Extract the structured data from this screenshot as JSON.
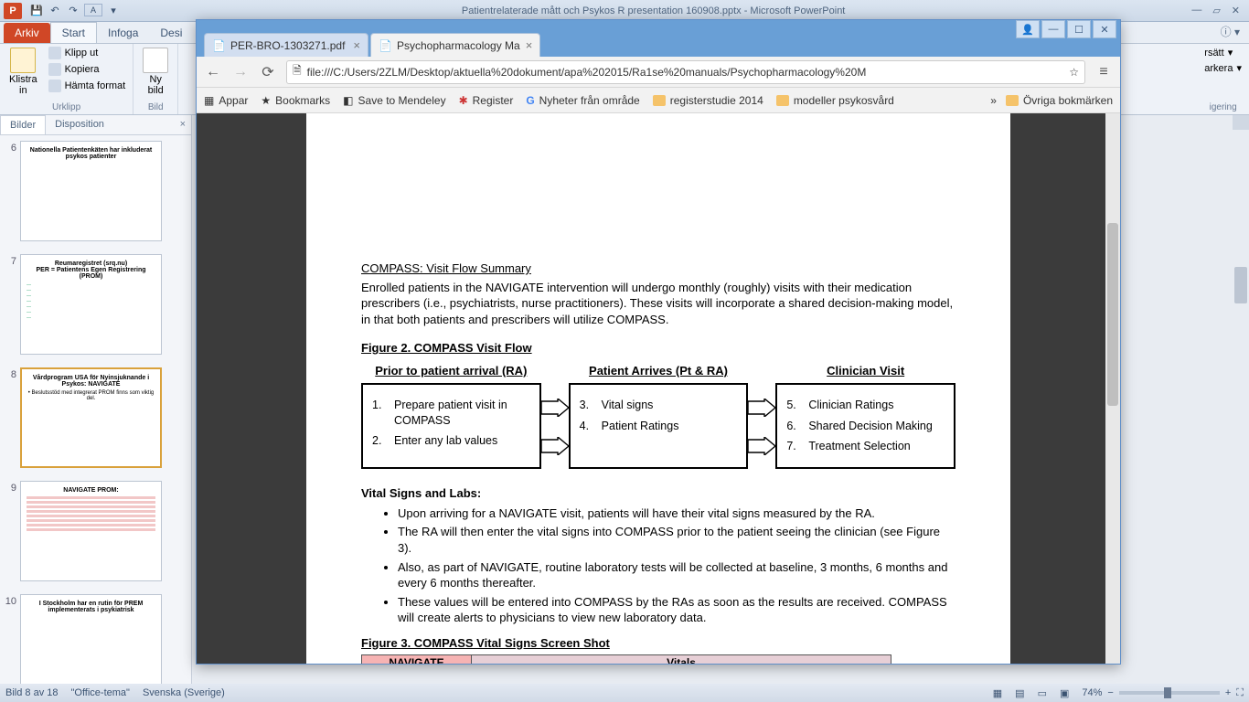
{
  "powerpoint": {
    "title": "Patientrelaterade mått och Psykos R presentation 160908.pptx  -  Microsoft PowerPoint",
    "logo": "P",
    "tabs": {
      "file": "Arkiv",
      "home": "Start",
      "insert": "Infoga",
      "design": "Desi"
    },
    "ribbon": {
      "clipboard": {
        "label": "Urklipp",
        "paste": "Klistra\nin",
        "cut": "Klipp ut",
        "copy": "Kopiera",
        "format": "Hämta format"
      },
      "slides": {
        "label": "Bild",
        "new": "Ny\nbild"
      },
      "right_peek": {
        "replace": "rsätt",
        "select": "arkera",
        "group": "igering"
      }
    },
    "pane": {
      "tab_slides": "Bilder",
      "tab_outline": "Disposition"
    },
    "thumbs": [
      {
        "n": "6",
        "title": "Nationella Patientenkäten har inkluderat psykos patienter"
      },
      {
        "n": "7",
        "title": "Reumaregistret (srq.nu)\nPER = Patientens Egen Registrering (PROM)"
      },
      {
        "n": "8",
        "title": "Vårdprogram USA för Nyinsjuknande i Psykos: NAVIGATE",
        "bullet": "Beslutsstöd med integrerat PROM finns som viktig del.",
        "selected": true
      },
      {
        "n": "9",
        "title": "NAVIGATE PROM:"
      },
      {
        "n": "10",
        "title": "I Stockholm har en rutin för PREM implementerats i psykiatrisk"
      }
    ],
    "status": {
      "slide": "Bild 8 av 18",
      "theme": "\"Office-tema\"",
      "lang": "Svenska (Sverige)",
      "zoom": "74%"
    }
  },
  "chrome": {
    "tabs": [
      {
        "title": "PER-BRO-1303271.pdf",
        "active": false
      },
      {
        "title": "Psychopharmacology Ma",
        "active": true
      }
    ],
    "url": "file:///C:/Users/2ZLM/Desktop/aktuella%20dokument/apa%202015/Ra1se%20manuals/Psychopharmacology%20M",
    "bookmarks": {
      "apps": "Appar",
      "bookmarks": "Bookmarks",
      "mendeley": "Save to Mendeley",
      "register": "Register",
      "nyheter": "Nyheter från område",
      "reg2014": "registerstudie 2014",
      "modeller": "modeller psykosvård",
      "ovriga": "Övriga bokmärken"
    }
  },
  "doc": {
    "h1": "COMPASS: Visit Flow Summary",
    "p1": "Enrolled patients in the NAVIGATE intervention will undergo monthly (roughly) visits with their medication prescribers (i.e., psychiatrists, nurse practitioners). These visits will incorporate a shared decision-making model, in that both patients and prescribers will utilize COMPASS.",
    "fig2": "Figure 2. COMPASS Visit Flow",
    "col1_h": "Prior to patient arrival (RA)",
    "col2_h": "Patient Arrives (Pt & RA)",
    "col3_h": "Clinician Visit",
    "c1_1": "Prepare patient visit in COMPASS",
    "c1_2": "Enter any lab values",
    "c2_3": "Vital signs",
    "c2_4": "Patient Ratings",
    "c3_5": "Clinician Ratings",
    "c3_6": "Shared Decision Making",
    "c3_7": "Treatment Selection",
    "vsl_h": "Vital Signs and Labs:",
    "b1": "Upon arriving for a NAVIGATE visit, patients will have their vital signs measured by the RA.",
    "b2": "The RA will then enter the vital signs into COMPASS prior to the patient seeing the clinician (see Figure 3).",
    "b3": "Also, as part of NAVIGATE, routine laboratory tests will be collected at baseline, 3 months, 6 months and every 6 months thereafter.",
    "b4": "These values will be entered into COMPASS by the RAs as soon as the results are received. COMPASS will create alerts to physicians to view new laboratory data.",
    "fig3": "Figure 3. COMPASS Vital Signs Screen Shot",
    "nav": "NAVIGATE",
    "vit": "Vitals"
  }
}
